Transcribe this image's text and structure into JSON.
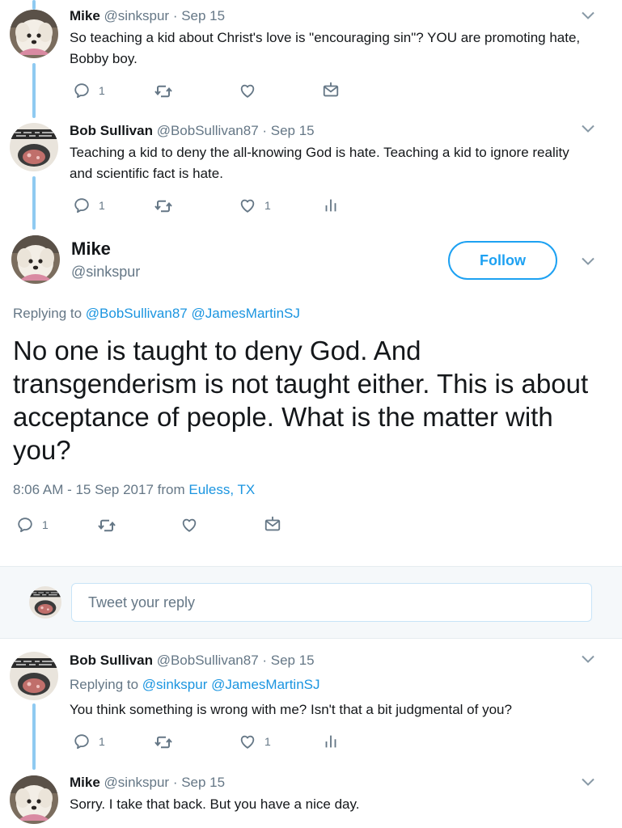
{
  "tweet1": {
    "name": "Mike",
    "meta": "@sinkspur · Sep 15",
    "text": "So teaching a kid about Christ's love is \"encouraging sin\"?  YOU are promoting hate, Bobby boy.",
    "reply_count": "1"
  },
  "tweet2": {
    "name": "Bob Sullivan",
    "meta": "@BobSullivan87 · Sep 15",
    "text": "Teaching a kid to deny the all-knowing God is hate. Teaching a kid to ignore reality and scientific fact is hate.",
    "reply_count": "1",
    "like_count": "1"
  },
  "focus": {
    "name": "Mike",
    "handle": "@sinkspur",
    "follow_label": "Follow",
    "replying_prefix": "Replying to",
    "replying_to_1": "@BobSullivan87",
    "replying_to_2": "@JamesMartinSJ",
    "text": "No one is taught to deny God.  And transgenderism is not taught either. This is about acceptance of people. What is the matter with you?",
    "timestamp": "8:06 AM - 15 Sep 2017 from",
    "location": "Euless, TX",
    "reply_count": "1"
  },
  "reply_box": {
    "placeholder": "Tweet your reply"
  },
  "tweet3": {
    "name": "Bob Sullivan",
    "meta": "@BobSullivan87 · Sep 15",
    "replying_prefix": "Replying to",
    "replying_to_1": "@sinkspur",
    "replying_to_2": "@JamesMartinSJ",
    "text": "You think something is wrong with me? Isn't that a bit judgmental of you?",
    "reply_count": "1",
    "like_count": "1"
  },
  "tweet4": {
    "name": "Mike",
    "meta": "@sinkspur · Sep 15",
    "text": "Sorry. I take that back.  But you have a nice day."
  },
  "colors": {
    "accent": "#1da1f2",
    "link": "#1b95e0",
    "muted": "#657786",
    "thread_line": "#8fcaf1"
  }
}
